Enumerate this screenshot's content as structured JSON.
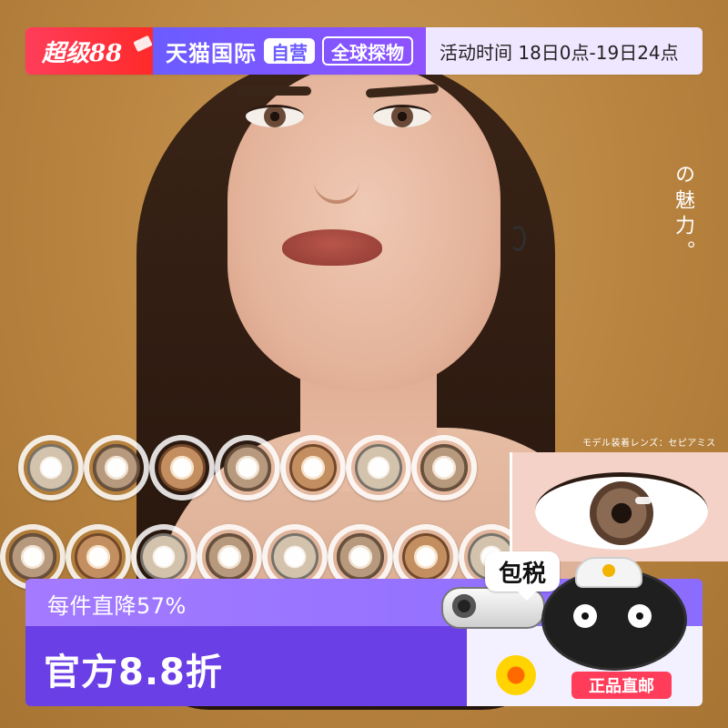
{
  "top_banner": {
    "badge_text": "超级88",
    "tmall_text": "天猫国际",
    "pill_1": "自营",
    "pill_2": "全球探物",
    "time_text": "活动时间  18日0点-19日24点"
  },
  "overlay_jp_text": "の魅力。",
  "closeup": {
    "model_label": "モデル装着レンズ：セピアミス"
  },
  "bottom": {
    "promo_1": "每件直降57%",
    "promo_2": "官方8.8折",
    "tax_text": "包税",
    "direct_text": "正品直邮"
  },
  "colors": {
    "purple": "#8b6cff",
    "deep_purple": "#6a3fe6",
    "red": "#ff3d5a"
  }
}
